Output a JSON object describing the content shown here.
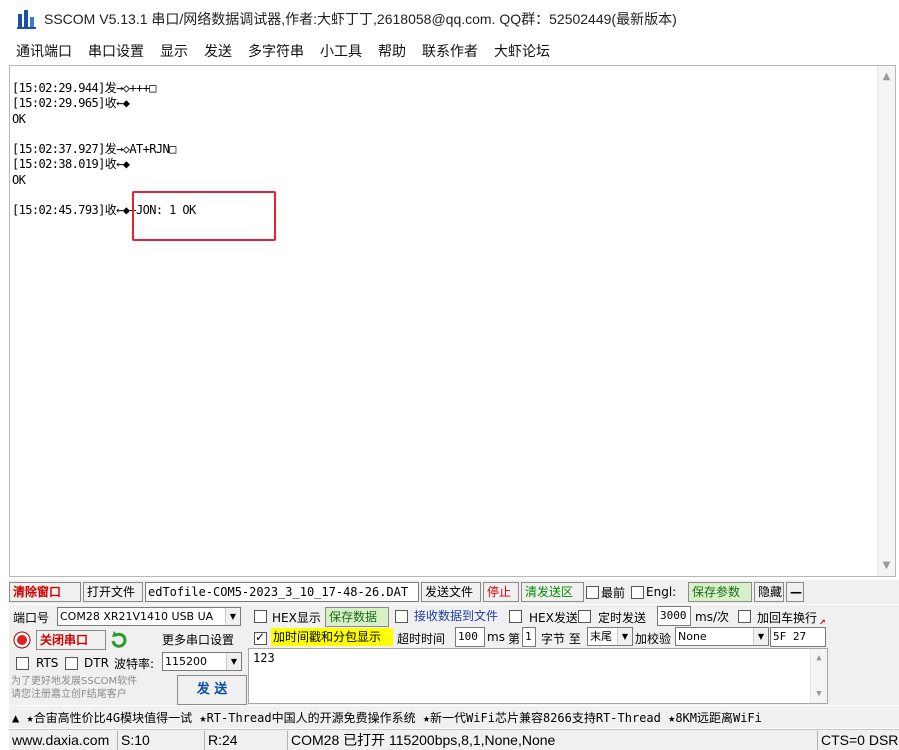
{
  "window": {
    "title": "SSCOM V5.13.1 串口/网络数据调试器,作者:大虾丁丁,2618058@qq.com. QQ群：52502449(最新版本)"
  },
  "menu": [
    "通讯端口",
    "串口设置",
    "显示",
    "发送",
    "多字符串",
    "小工具",
    "帮助",
    "联系作者",
    "大虾论坛"
  ],
  "receive": {
    "lines": [
      "[15:02:29.944]发→◇+++□",
      "[15:02:29.965]收←◆",
      "OK",
      "",
      "[15:02:37.927]发→◇AT+RJN□",
      "[15:02:38.019]收←◆",
      "OK",
      "",
      "[15:02:45.793]收←◆+JON: 1 OK"
    ]
  },
  "toolbar": {
    "clear_window": "清除窗口",
    "open_file": "打开文件",
    "file_path": "edTofile-COM5-2023_3_10_17-48-26.DAT",
    "send_file": "发送文件",
    "stop": "停止",
    "clear_send": "清发送区",
    "topmost": "最前",
    "english": "Engl:",
    "save_params": "保存参数",
    "hide": "隐藏",
    "collapse": "—"
  },
  "port": {
    "label": "端口号",
    "value": "COM28  XR21V1410 USB UA",
    "close_port": "关闭串口",
    "more_settings": "更多串口设置",
    "rts": "RTS",
    "dtr": "DTR",
    "baud_label": "波特率:",
    "baud_value": "115200",
    "promo": "为了更好地发展SSCOM软件\n请您注册嘉立创F结尾客户",
    "send": "发 送"
  },
  "options": {
    "hex_display": "HEX显示",
    "save_data": "保存数据",
    "recv_to_file": "接收数据到文件",
    "hex_send": "HEX发送",
    "timed_send": "定时发送",
    "interval": "3000",
    "interval_unit": "ms/次",
    "add_crlf": "加回车换行",
    "timestamp": "加时间戳和分包显示",
    "timeout_label": "超时时间",
    "timeout_value": "100",
    "timeout_unit": "ms",
    "byte_prefix": "第",
    "byte_index": "1",
    "byte_label": "字节 至",
    "byte_end": "末尾",
    "checksum_label": "加校验",
    "checksum_value": "None",
    "hex_preview": "5F 27"
  },
  "send_box": {
    "value": "123"
  },
  "ticker": "▲ ★合宙高性价比4G模块值得一试   ★RT-Thread中国人的开源免费操作系统   ★新一代WiFi芯片兼容8266支持RT-Thread   ★8KM远距离WiFi",
  "status": {
    "website": "www.daxia.com",
    "sent": "S:10",
    "received": "R:24",
    "port_state": "COM28 已打开  115200bps,8,1,None,None",
    "signals": "CTS=0 DSR"
  },
  "colors": {
    "highlight_box": "#e3262c",
    "stop_text": "#d00000",
    "timestamp_bg": "#ffff00"
  }
}
